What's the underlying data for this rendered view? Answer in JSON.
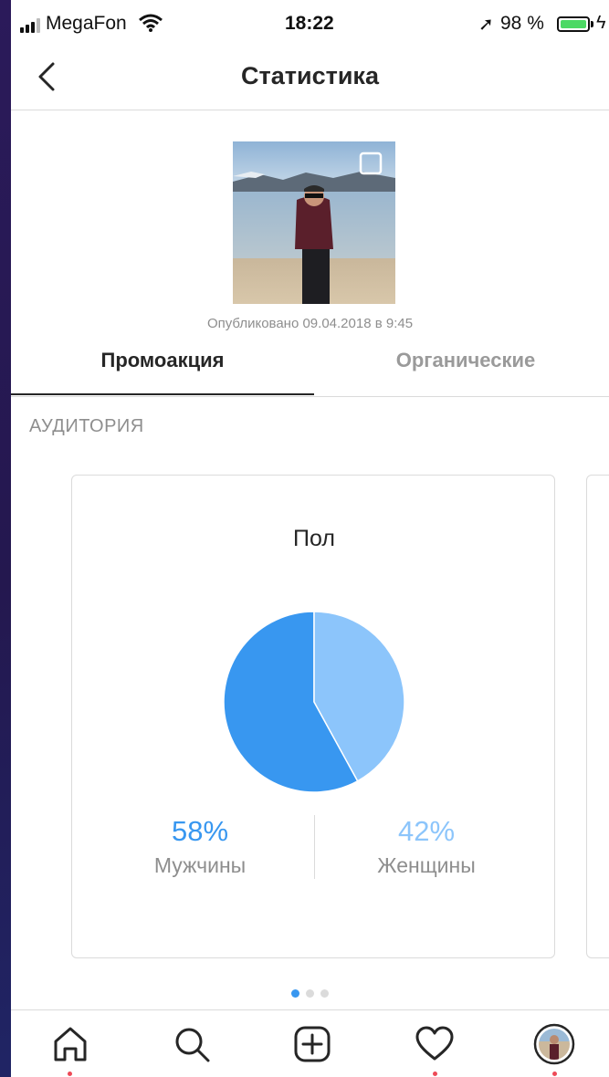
{
  "status_bar": {
    "carrier": "MegaFon",
    "time": "18:22",
    "battery": "98 %"
  },
  "nav": {
    "title": "Статистика"
  },
  "post": {
    "published": "Опубликовано 09.04.2018 в 9:45"
  },
  "tabs": [
    {
      "label": "Промоакция",
      "active": true
    },
    {
      "label": "Органические",
      "active": false
    }
  ],
  "section_label": "АУДИТОРИЯ",
  "gender_card": {
    "title": "Пол",
    "male": {
      "percent": "58%",
      "label": "Мужчины",
      "color": "#3897f0"
    },
    "female": {
      "percent": "42%",
      "label": "Женщины",
      "color": "#8cc5fb"
    }
  },
  "chart_data": {
    "type": "pie",
    "title": "Пол",
    "categories": [
      "Мужчины",
      "Женщины"
    ],
    "values": [
      58,
      42
    ],
    "colors": [
      "#3897f0",
      "#8cc5fb"
    ]
  },
  "pager": {
    "count": 3,
    "active": 0
  },
  "tab_bar": [
    "home-icon",
    "search-icon",
    "add-post-icon",
    "activity-heart-icon",
    "profile-avatar"
  ]
}
